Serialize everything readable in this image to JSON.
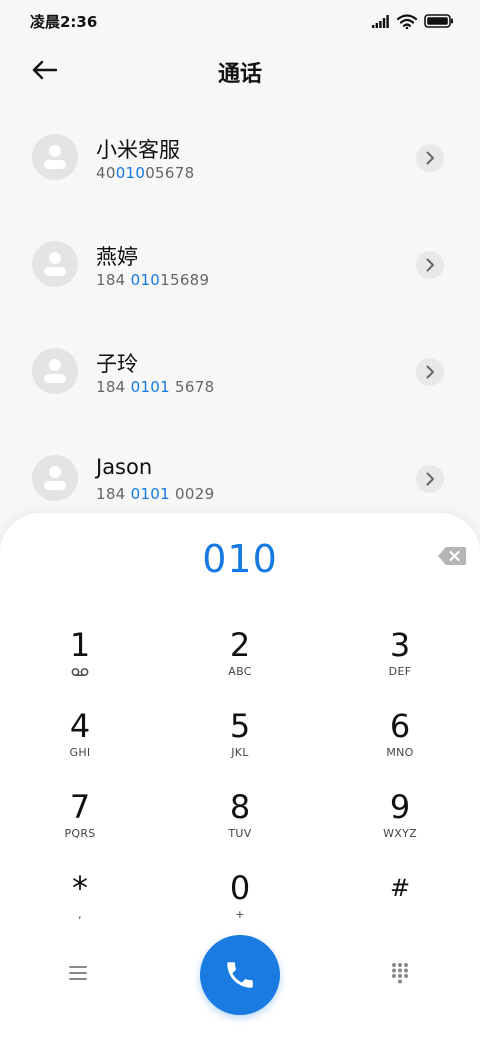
{
  "status_bar": {
    "time": "凌晨2:36",
    "icons": [
      "signal-icon",
      "wifi-icon",
      "battery-icon"
    ]
  },
  "header": {
    "title": "通话",
    "back_icon": "arrow-left-icon"
  },
  "contacts": [
    {
      "name": "小米客服",
      "number_parts": [
        "40",
        "010",
        "05678"
      ]
    },
    {
      "name": "燕婷",
      "number_parts": [
        "184 ",
        "010",
        "15689"
      ]
    },
    {
      "name": "子玲",
      "number_parts": [
        "184 ",
        "0101",
        " 5678"
      ]
    },
    {
      "name": "Jason",
      "number_parts": [
        "184 ",
        "0101",
        " 0029"
      ]
    }
  ],
  "dialpad": {
    "input_value": "010",
    "keys": [
      {
        "digit": "1",
        "letters": ""
      },
      {
        "digit": "2",
        "letters": "ABC"
      },
      {
        "digit": "3",
        "letters": "DEF"
      },
      {
        "digit": "4",
        "letters": "GHI"
      },
      {
        "digit": "5",
        "letters": "JKL"
      },
      {
        "digit": "6",
        "letters": "MNO"
      },
      {
        "digit": "7",
        "letters": "PQRS"
      },
      {
        "digit": "8",
        "letters": "TUV"
      },
      {
        "digit": "9",
        "letters": "WXYZ"
      },
      {
        "digit": "*",
        "letters": ","
      },
      {
        "digit": "0",
        "letters": "+"
      },
      {
        "digit": "#",
        "letters": ""
      }
    ]
  },
  "colors": {
    "accent": "#1479e0",
    "call_button": "#1a7be0",
    "avatar_bg": "#e3e4e6"
  }
}
